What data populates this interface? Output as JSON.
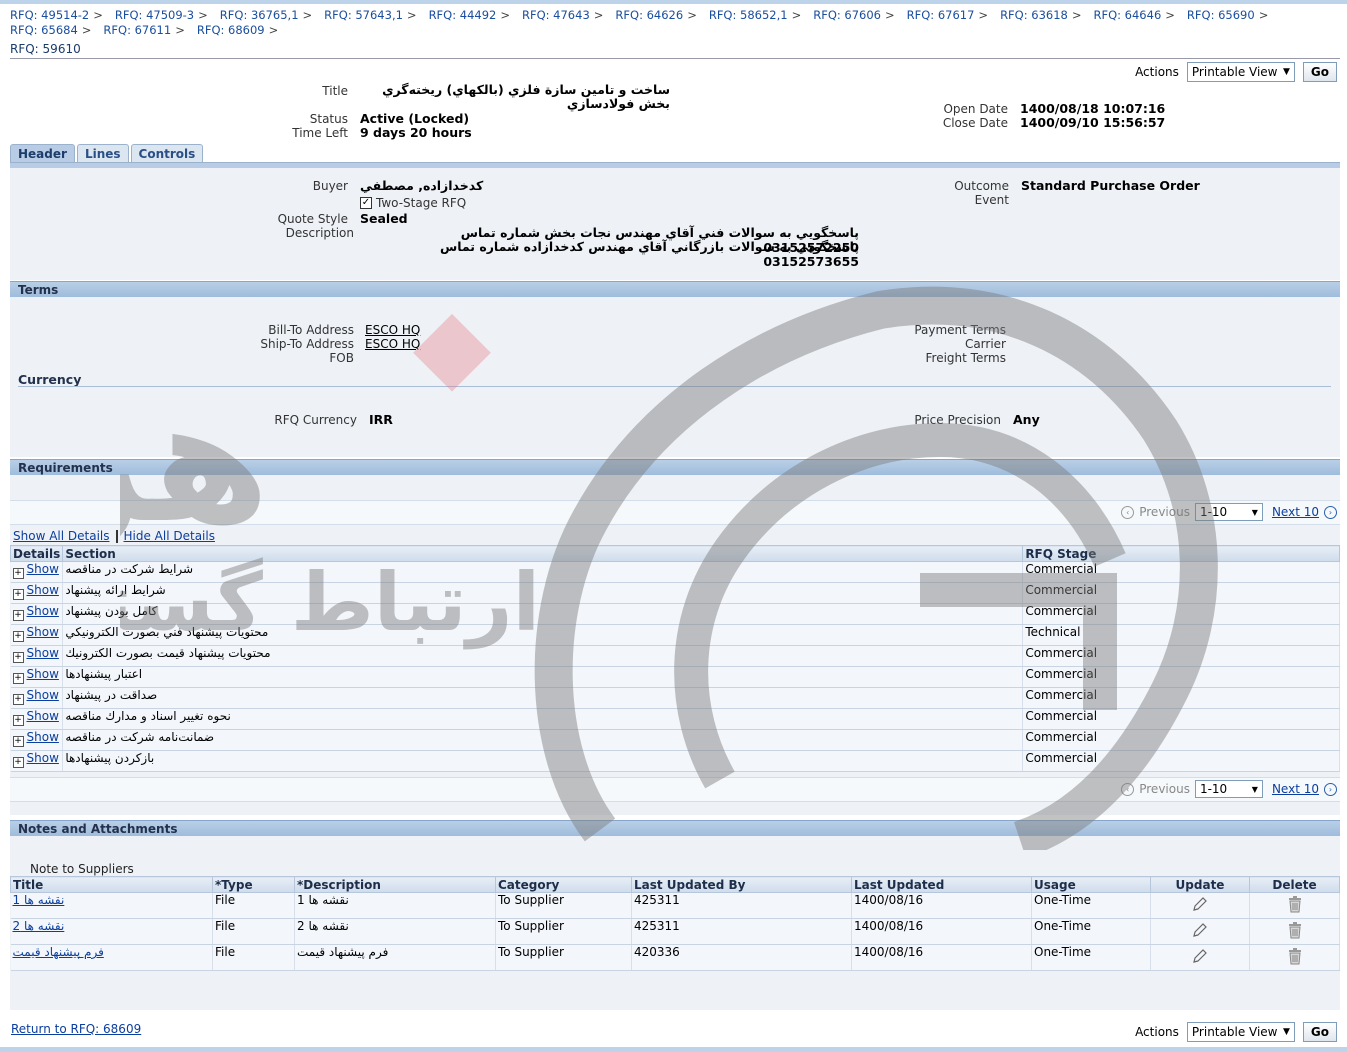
{
  "breadcrumbs": [
    {
      "label": "RFQ: 49514-2"
    },
    {
      "label": "RFQ: 47509-3"
    },
    {
      "label": "RFQ: 36765,1"
    },
    {
      "label": "RFQ: 57643,1"
    },
    {
      "label": "RFQ: 44492"
    },
    {
      "label": "RFQ: 47643"
    },
    {
      "label": "RFQ: 64626"
    },
    {
      "label": "RFQ: 58652,1"
    },
    {
      "label": "RFQ: 67606"
    },
    {
      "label": "RFQ: 67617"
    },
    {
      "label": "RFQ: 63618"
    },
    {
      "label": "RFQ: 64646"
    },
    {
      "label": "RFQ: 65690"
    },
    {
      "label": "RFQ: 65684"
    },
    {
      "label": "RFQ: 67611"
    },
    {
      "label": "RFQ: 68609"
    }
  ],
  "breadcrumb_sep": ">",
  "page_title": "RFQ: 59610",
  "actions": {
    "label": "Actions",
    "selected": "Printable View",
    "go": "Go"
  },
  "summary": {
    "title_label": "Title",
    "title_value": "ساخت و تامين سازة فلزي (بالكهاي) ريخته‌گري بخش فولادسازي",
    "status_label": "Status",
    "status_value": "Active (Locked)",
    "time_left_label": "Time Left",
    "time_left_value": "9 days 20 hours",
    "open_date_label": "Open Date",
    "open_date_value": "1400/08/18 10:07:16",
    "close_date_label": "Close Date",
    "close_date_value": "1400/09/10 15:56:57"
  },
  "tabs": [
    "Header",
    "Lines",
    "Controls"
  ],
  "header_section": {
    "buyer_label": "Buyer",
    "buyer_value": "كدخدازاده, مصطفي",
    "two_stage_label": "Two-Stage RFQ",
    "quote_style_label": "Quote Style",
    "quote_style_value": "Sealed",
    "description_label": "Description",
    "description_line1": "پاسخگويي به سوالات فني آقاي مهندس نجات بخش شماره تماس 03152572250",
    "description_line2": "پاسخگويي به سوالات بازرگاني آقاي مهندس كدخدازاده شماره تماس 03152573655",
    "outcome_label": "Outcome",
    "outcome_value": "Standard Purchase Order",
    "event_label": "Event"
  },
  "terms": {
    "heading": "Terms",
    "bill_to_label": "Bill-To Address",
    "bill_to_value": "ESCO HQ",
    "ship_to_label": "Ship-To Address",
    "ship_to_value": "ESCO HQ",
    "fob_label": "FOB",
    "payment_terms_label": "Payment Terms",
    "carrier_label": "Carrier",
    "freight_terms_label": "Freight Terms",
    "currency_heading": "Currency",
    "rfq_currency_label": "RFQ Currency",
    "rfq_currency_value": "IRR",
    "price_precision_label": "Price Precision",
    "price_precision_value": "Any"
  },
  "requirements": {
    "heading": "Requirements",
    "pager": {
      "previous": "Previous",
      "range": "1-10",
      "next": "Next 10"
    },
    "show_all": "Show All Details",
    "hide_all": "Hide All Details",
    "columns": [
      "Details",
      "Section",
      "RFQ Stage"
    ],
    "show_label": "Show",
    "rows": [
      {
        "section": "شرايط شركت در مناقصه",
        "stage": "Commercial"
      },
      {
        "section": "شرايط ارائه پيشنهاد",
        "stage": "Commercial"
      },
      {
        "section": "كامل بودن پيشنهاد",
        "stage": "Commercial"
      },
      {
        "section": "محتويات پيشنهاد فني بصورت الكترونيكي",
        "stage": "Technical"
      },
      {
        "section": "محتويات پيشنهاد قيمت بصورت الكترونيك",
        "stage": "Commercial"
      },
      {
        "section": "اعتبار پيشنهادها",
        "stage": "Commercial"
      },
      {
        "section": "صداقت در پيشنهاد",
        "stage": "Commercial"
      },
      {
        "section": "نحوه تغيير اسناد و مدارك مناقصه",
        "stage": "Commercial"
      },
      {
        "section": "ضمانت‌نامه شركت در مناقصه",
        "stage": "Commercial"
      },
      {
        "section": "بازكردن پيشنهادها",
        "stage": "Commercial"
      }
    ]
  },
  "notes": {
    "heading": "Notes and Attachments",
    "note_to_suppliers": "Note to Suppliers",
    "columns": [
      "Title",
      "*Type",
      "*Description",
      "Category",
      "Last Updated By",
      "Last Updated",
      "Usage",
      "Update",
      "Delete"
    ],
    "rows": [
      {
        "title": "نقشه ها 1",
        "type": "File",
        "description": "نقشه ها 1",
        "category": "To Supplier",
        "updated_by": "425311",
        "updated": "1400/08/16",
        "usage": "One-Time"
      },
      {
        "title": "نقشه ها 2",
        "type": "File",
        "description": "نقشه ها 2",
        "category": "To Supplier",
        "updated_by": "425311",
        "updated": "1400/08/16",
        "usage": "One-Time"
      },
      {
        "title": "فرم پيشنهاد قيمت",
        "type": "File",
        "description": "فرم پيشنهاد قيمت",
        "category": "To Supplier",
        "updated_by": "420336",
        "updated": "1400/08/16",
        "usage": "One-Time"
      }
    ]
  },
  "footer": {
    "return_link": "Return to RFQ: 68609"
  },
  "watermark": {
    "line1": "هزاره",
    "line2": "ارتباط گستران"
  },
  "colors": {
    "section_bar": "#a9c3e0",
    "panel_bg": "#eef2f7",
    "link": "#0b3e9e",
    "watermark": "#7a7a7a",
    "watermark_accent": "#e8707a"
  }
}
